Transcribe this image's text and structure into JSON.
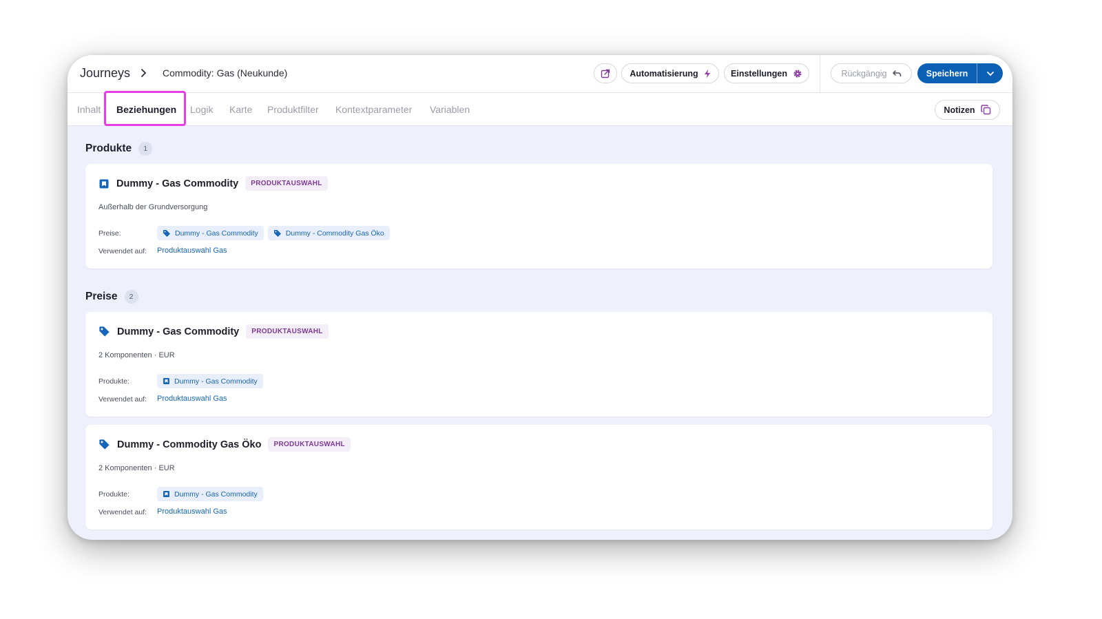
{
  "header": {
    "breadcrumb_root": "Journeys",
    "title": "Commodity: Gas (Neukunde)",
    "automation_label": "Automatisierung",
    "settings_label": "Einstellungen",
    "undo_label": "Rückgängig",
    "save_label": "Speichern"
  },
  "tabs": [
    {
      "label": "Inhalt",
      "active": false
    },
    {
      "label": "Beziehungen",
      "active": true
    },
    {
      "label": "Logik",
      "active": false
    },
    {
      "label": "Karte",
      "active": false
    },
    {
      "label": "Produktfilter",
      "active": false
    },
    {
      "label": "Kontextparameter",
      "active": false
    },
    {
      "label": "Variablen",
      "active": false
    }
  ],
  "notes_label": "Notizen",
  "products_section": {
    "title": "Produkte",
    "count": "1",
    "cards": [
      {
        "icon": "product-icon",
        "title": "Dummy - Gas Commodity",
        "badge": "PRODUKTAUSWAHL",
        "description": "Außerhalb der Grundversorgung",
        "related_label": "Preise:",
        "related": [
          "Dummy - Gas Commodity",
          "Dummy - Commodity Gas Öko"
        ],
        "used_on_label": "Verwendet auf:",
        "used_on": "Produktauswahl Gas"
      }
    ]
  },
  "prices_section": {
    "title": "Preise",
    "count": "2",
    "cards": [
      {
        "icon": "price-tag-icon",
        "title": "Dummy - Gas Commodity",
        "badge": "PRODUKTAUSWAHL",
        "description": "2 Komponenten · EUR",
        "related_label": "Produkte:",
        "related": [
          "Dummy - Gas Commodity"
        ],
        "used_on_label": "Verwendet auf:",
        "used_on": "Produktauswahl Gas"
      },
      {
        "icon": "price-tag-icon",
        "title": "Dummy - Commodity Gas Öko",
        "badge": "PRODUKTAUSWAHL",
        "description": "2 Komponenten · EUR",
        "related_label": "Produkte:",
        "related": [
          "Dummy - Gas Commodity"
        ],
        "used_on_label": "Verwendet auf:",
        "used_on": "Produktauswahl Gas"
      }
    ]
  },
  "colors": {
    "primary": "#0b5fb5",
    "highlight": "#e83ce6",
    "badge_text": "#7d3a93",
    "link": "#1565b8"
  }
}
